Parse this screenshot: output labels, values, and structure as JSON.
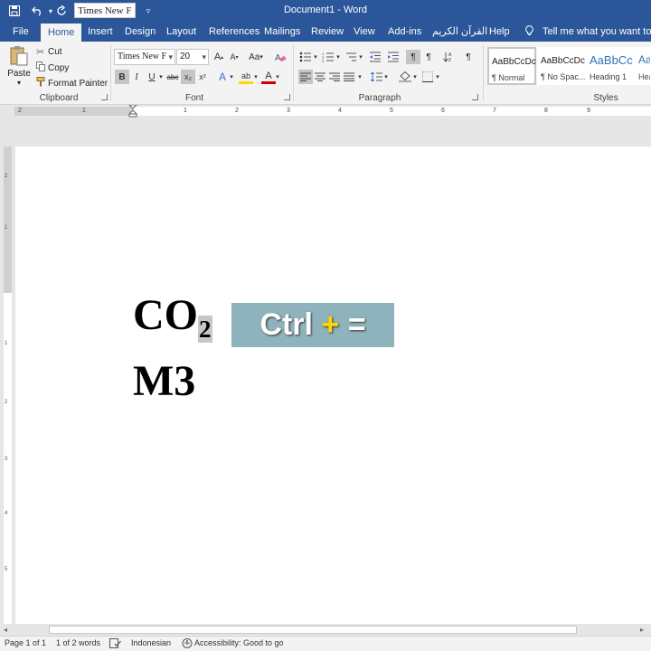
{
  "window": {
    "title": "Document1  -  Word",
    "qat_font": "Times New F"
  },
  "tabs": [
    "File",
    "Home",
    "Insert",
    "Design",
    "Layout",
    "References",
    "Mailings",
    "Review",
    "View",
    "Add-ins",
    "القرآن الكريم",
    "Help"
  ],
  "active_tab": "Home",
  "tell_me": "Tell me what you want to do",
  "clipboard": {
    "paste": "Paste",
    "cut": "Cut",
    "copy": "Copy",
    "format_painter": "Format Painter",
    "label": "Clipboard"
  },
  "font": {
    "name": "Times New F",
    "size": "20",
    "label": "Font",
    "grow": "A",
    "shrink": "A",
    "case": "Aa",
    "bold": "B",
    "italic": "I",
    "underline": "U",
    "strike": "abc",
    "subscript": "x₂",
    "superscript": "x²",
    "text_effects": "A",
    "highlight": "ab",
    "font_color": "A"
  },
  "paragraph": {
    "label": "Paragraph",
    "pilcrow": "¶"
  },
  "styles": {
    "label": "Styles",
    "items": [
      {
        "sample": "AaBbCcDc",
        "name": "¶ Normal"
      },
      {
        "sample": "AaBbCcDc",
        "name": "¶ No Spac..."
      },
      {
        "sample": "AaBbCc",
        "name": "Heading 1"
      },
      {
        "sample": "AaB",
        "name": "Head"
      }
    ]
  },
  "ruler_numbers": [
    "2",
    "1",
    "1",
    "2",
    "3",
    "4",
    "5",
    "6",
    "7",
    "8",
    "9"
  ],
  "vruler_numbers": [
    "2",
    "1",
    "1",
    "2",
    "3",
    "4",
    "5"
  ],
  "document": {
    "line1_main": "CO",
    "line1_sub": "2",
    "line2": "M3"
  },
  "overlay": {
    "ctrl": "Ctrl",
    "plus": "+",
    "key": "="
  },
  "status": {
    "page": "Page 1 of 1",
    "words": "1 of 2 words",
    "language": "Indonesian",
    "accessibility": "Accessibility: Good to go"
  },
  "colors": {
    "brand": "#2b579a",
    "highlight_yellow": "#ffd700",
    "font_color_red": "#d00000",
    "overlay_bg": "#8fb3bd"
  }
}
